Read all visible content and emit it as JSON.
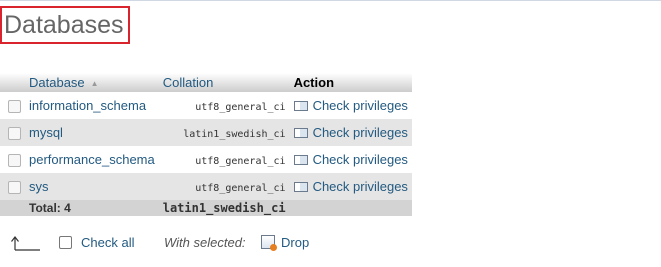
{
  "page": {
    "title": "Databases"
  },
  "table": {
    "headers": {
      "database": "Database",
      "collation": "Collation",
      "action": "Action"
    },
    "rows": [
      {
        "name": "information_schema",
        "collation": "utf8_general_ci",
        "action": "Check privileges"
      },
      {
        "name": "mysql",
        "collation": "latin1_swedish_ci",
        "action": "Check privileges"
      },
      {
        "name": "performance_schema",
        "collation": "utf8_general_ci",
        "action": "Check privileges"
      },
      {
        "name": "sys",
        "collation": "utf8_general_ci",
        "action": "Check privileges"
      }
    ],
    "total": {
      "label": "Total: 4",
      "collation": "latin1_swedish_ci"
    }
  },
  "footer": {
    "check_all": "Check all",
    "with_selected": "With selected:",
    "drop": "Drop"
  },
  "icons": {
    "sort": "sort-ascending-icon",
    "privileges": "privileges-icon",
    "arrow": "arrow-to-selection-icon",
    "drop": "drop-icon"
  },
  "colors": {
    "accent_link": "#235a81",
    "title_border": "#d9232d",
    "row_alt": "#e5e5e5"
  }
}
